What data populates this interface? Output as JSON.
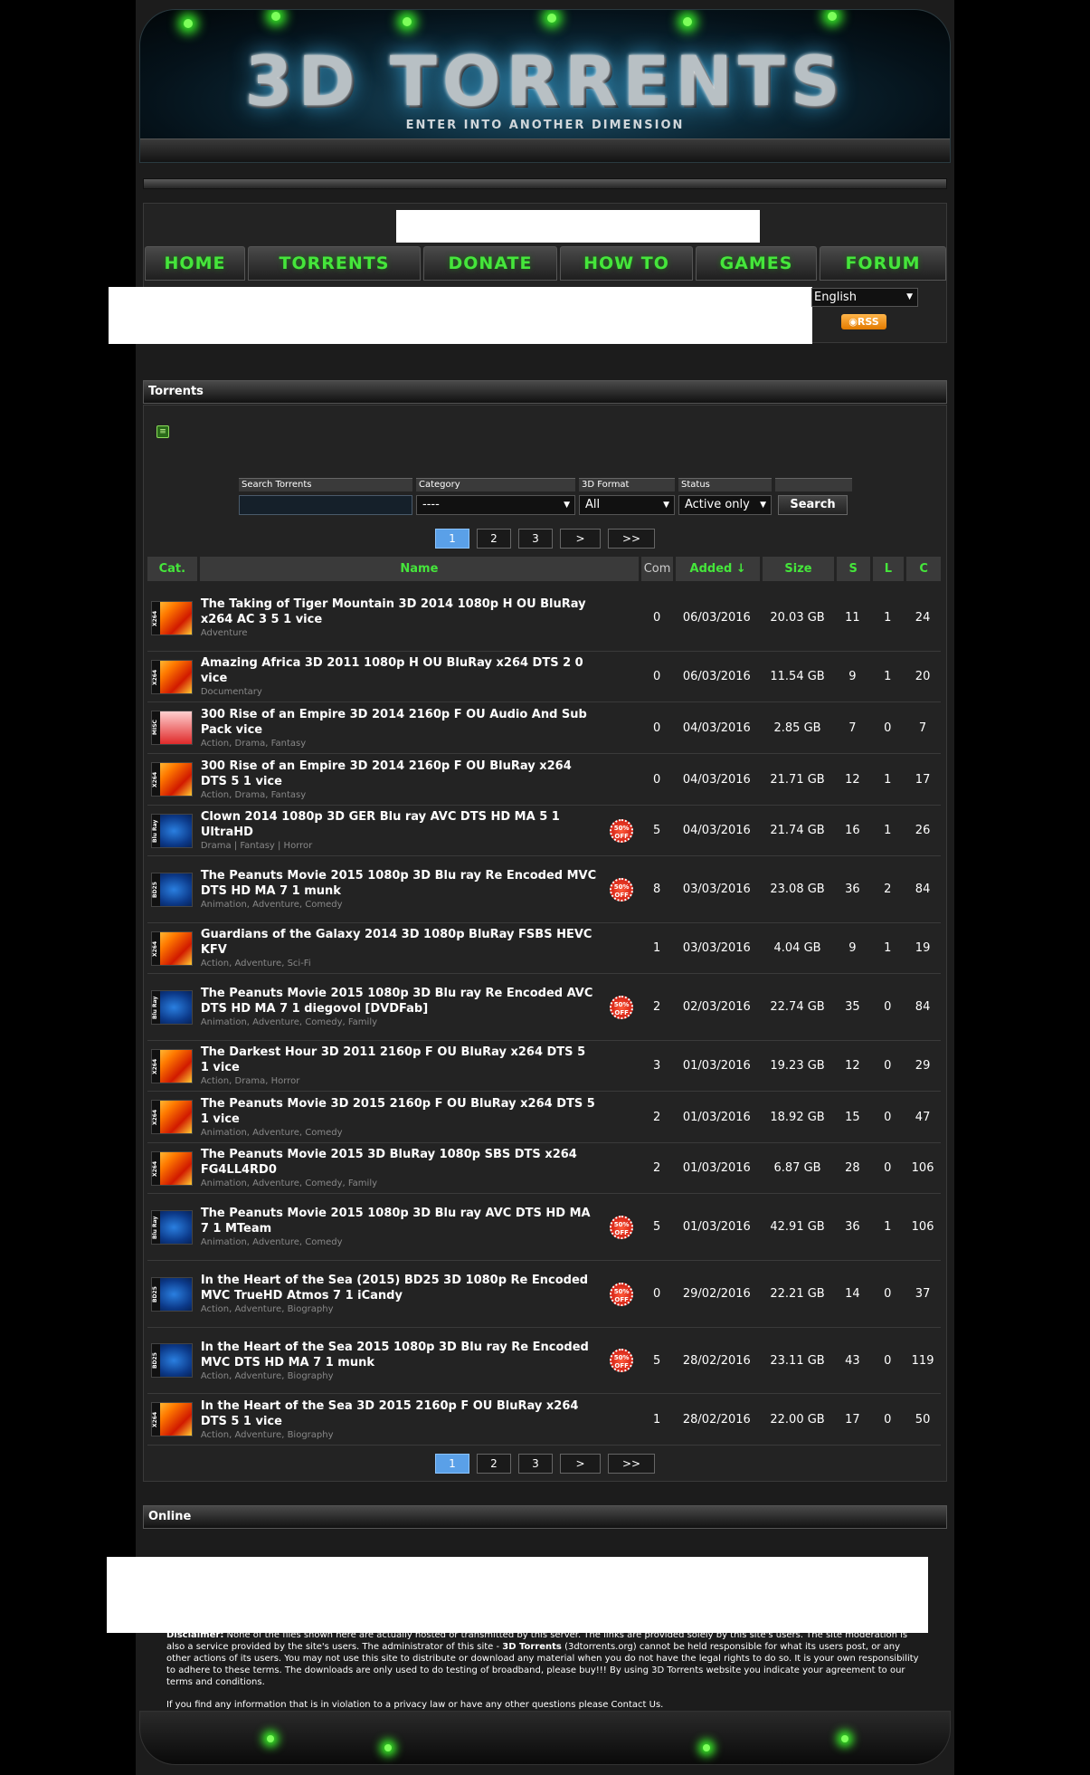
{
  "banner": {
    "logo": "3D TORRENTS",
    "tagline": "ENTER INTO ANOTHER DIMENSION"
  },
  "nav": [
    "HOME",
    "TORRENTS",
    "DONATE",
    "HOW TO",
    "GAMES",
    "FORUM"
  ],
  "language": {
    "selected": "English"
  },
  "rss_label": "RSS",
  "sections": {
    "torrents": "Torrents",
    "online": "Online"
  },
  "search": {
    "labels": {
      "search": "Search Torrents",
      "category": "Category",
      "format": "3D Format",
      "status": "Status"
    },
    "category_value": "----",
    "format_value": "All",
    "status_value": "Active only",
    "button": "Search"
  },
  "pager": [
    "1",
    "2",
    "3",
    ">",
    ">>"
  ],
  "columns": {
    "cat": "Cat.",
    "name": "Name",
    "com": "Com",
    "added": "Added ↓",
    "size": "Size",
    "s": "S",
    "l": "L",
    "c": "C"
  },
  "rows": [
    {
      "cat": "x264",
      "title": "The Taking of Tiger Mountain 3D 2014 1080p H OU BluRay x264 AC 3 5 1 vice",
      "genre": "Adventure",
      "com": "0",
      "added": "06/03/2016",
      "size": "20.03 GB",
      "s": "11",
      "l": "1",
      "c": "24",
      "badge": false
    },
    {
      "cat": "x264",
      "title": "Amazing Africa 3D 2011 1080p H OU BluRay x264 DTS 2 0 vice",
      "genre": "Documentary",
      "com": "0",
      "added": "06/03/2016",
      "size": "11.54 GB",
      "s": "9",
      "l": "1",
      "c": "20",
      "badge": false
    },
    {
      "cat": "misc",
      "title": "300 Rise of an Empire 3D 2014 2160p F OU Audio And Sub Pack vice",
      "genre": "Action, Drama, Fantasy",
      "com": "0",
      "added": "04/03/2016",
      "size": "2.85 GB",
      "s": "7",
      "l": "0",
      "c": "7",
      "badge": false
    },
    {
      "cat": "x264",
      "title": "300 Rise of an Empire 3D 2014 2160p F OU BluRay x264 DTS 5 1 vice",
      "genre": "Action, Drama, Fantasy",
      "com": "0",
      "added": "04/03/2016",
      "size": "21.71 GB",
      "s": "12",
      "l": "1",
      "c": "17",
      "badge": false
    },
    {
      "cat": "bluray",
      "title": "Clown 2014 1080p 3D GER Blu ray AVC DTS HD MA 5 1 UltraHD",
      "genre": "Drama | Fantasy | Horror",
      "com": "5",
      "added": "04/03/2016",
      "size": "21.74 GB",
      "s": "16",
      "l": "1",
      "c": "26",
      "badge": true
    },
    {
      "cat": "bd25",
      "title": "The Peanuts Movie 2015 1080p 3D Blu ray Re Encoded MVC DTS HD MA 7 1 munk",
      "genre": "Animation, Adventure, Comedy",
      "com": "8",
      "added": "03/03/2016",
      "size": "23.08 GB",
      "s": "36",
      "l": "2",
      "c": "84",
      "badge": true
    },
    {
      "cat": "x264",
      "title": "Guardians of the Galaxy 2014 3D 1080p BluRay FSBS HEVC KFV",
      "genre": "Action, Adventure, Sci-Fi",
      "com": "1",
      "added": "03/03/2016",
      "size": "4.04 GB",
      "s": "9",
      "l": "1",
      "c": "19",
      "badge": false
    },
    {
      "cat": "bluray",
      "title": "The Peanuts Movie 2015 1080p 3D Blu ray Re Encoded AVC DTS HD MA 7 1 diegovol [DVDFab]",
      "genre": "Animation, Adventure, Comedy, Family",
      "com": "2",
      "added": "02/03/2016",
      "size": "22.74 GB",
      "s": "35",
      "l": "0",
      "c": "84",
      "badge": true
    },
    {
      "cat": "x264",
      "title": "The Darkest Hour 3D 2011 2160p F OU BluRay x264 DTS 5 1 vice",
      "genre": "Action, Drama, Horror",
      "com": "3",
      "added": "01/03/2016",
      "size": "19.23 GB",
      "s": "12",
      "l": "0",
      "c": "29",
      "badge": false
    },
    {
      "cat": "x264",
      "title": "The Peanuts Movie 3D 2015 2160p F OU BluRay x264 DTS 5 1 vice",
      "genre": "Animation, Adventure, Comedy",
      "com": "2",
      "added": "01/03/2016",
      "size": "18.92 GB",
      "s": "15",
      "l": "0",
      "c": "47",
      "badge": false
    },
    {
      "cat": "x264",
      "title": "The Peanuts Movie 2015 3D BluRay 1080p SBS DTS x264 FG4LL4RD0",
      "genre": "Animation, Adventure, Comedy, Family",
      "com": "2",
      "added": "01/03/2016",
      "size": "6.87 GB",
      "s": "28",
      "l": "0",
      "c": "106",
      "badge": false
    },
    {
      "cat": "bluray",
      "title": "The Peanuts Movie 2015 1080p 3D Blu ray AVC DTS HD MA 7 1 MTeam",
      "genre": "Animation, Adventure, Comedy",
      "com": "5",
      "added": "01/03/2016",
      "size": "42.91 GB",
      "s": "36",
      "l": "1",
      "c": "106",
      "badge": true
    },
    {
      "cat": "bd25",
      "title": "In the Heart of the Sea (2015) BD25 3D 1080p Re Encoded MVC TrueHD Atmos 7 1 iCandy",
      "genre": "Action, Adventure, Biography",
      "com": "0",
      "added": "29/02/2016",
      "size": "22.21 GB",
      "s": "14",
      "l": "0",
      "c": "37",
      "badge": true
    },
    {
      "cat": "bd25",
      "title": "In the Heart of the Sea 2015 1080p 3D Blu ray Re Encoded MVC DTS HD MA 7 1 munk",
      "genre": "Action, Adventure, Biography",
      "com": "5",
      "added": "28/02/2016",
      "size": "23.11 GB",
      "s": "43",
      "l": "0",
      "c": "119",
      "badge": true
    },
    {
      "cat": "x264",
      "title": "In the Heart of the Sea 3D 2015 2160p F OU BluRay x264 DTS 5 1 vice",
      "genre": "Action, Adventure, Biography",
      "com": "1",
      "added": "28/02/2016",
      "size": "22.00 GB",
      "s": "17",
      "l": "0",
      "c": "50",
      "badge": false
    }
  ],
  "cat_labels": {
    "x264": "X264",
    "bluray": "Blu Ray",
    "bd25": "BD25",
    "misc": "MISC"
  },
  "badge_text": "50% OFF",
  "disclaimer": {
    "lead": "Disclaimer:",
    "body_a": " None of the files shown here are actually hosted or transmitted by this server. The links are provided solely by this site's users. The site moderation is also a service provided by the site's users. The administrator of this site - ",
    "site": "3D Torrents",
    "body_b": " (3dtorrents.org) cannot be held responsible for what its users post, or any other actions of its users. You may not use this site to distribute or download any material when you do not have the legal rights to do so. It is your own responsibility to adhere to these terms. The downloads are only used to do testing of broadband, please buy!!! By using 3D Torrents website you indicate your agreement to our terms and conditions.",
    "privacy": "If you find any information that is in violation to a privacy law or have any other questions please Contact Us."
  }
}
